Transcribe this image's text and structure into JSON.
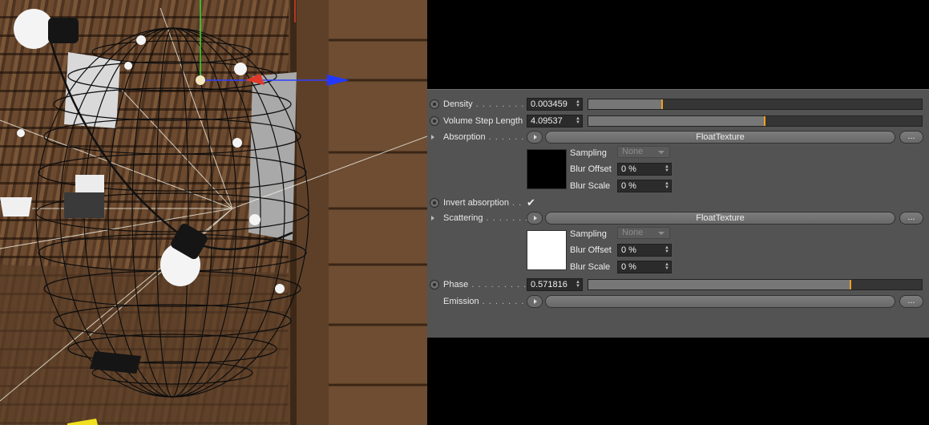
{
  "panel": {
    "density": {
      "label": "Density",
      "dots": " . . . . . . . . .",
      "value": "0.003459",
      "level": 0.22
    },
    "volume_step": {
      "label": "Volume Step Length",
      "value": "4.09537",
      "level": 0.53
    },
    "absorption": {
      "label": "Absorption",
      "dots": " . . . . . . .",
      "texture": "FloatTexture",
      "more": "...",
      "swatch_color": "#000000",
      "sampling_label": "Sampling",
      "sampling_value": "None",
      "blur_offset_label": "Blur Offset",
      "blur_offset_value": "0 %",
      "blur_scale_label": "Blur Scale",
      "blur_scale_value": "0 %"
    },
    "invert_absorption": {
      "label": "Invert absorption",
      "dots": " . .",
      "checked_glyph": "✔"
    },
    "scattering": {
      "label": "Scattering",
      "dots": " . . . . . . . .",
      "texture": "FloatTexture",
      "more": "...",
      "swatch_color": "#ffffff",
      "sampling_label": "Sampling",
      "sampling_value": "None",
      "blur_offset_label": "Blur Offset",
      "blur_offset_value": "0 %",
      "blur_scale_label": "Blur Scale",
      "blur_scale_value": "0 %"
    },
    "phase": {
      "label": "Phase",
      "dots": " . . . . . . . . . . .",
      "value": "0.571816",
      "level": 0.785
    },
    "emission": {
      "label": "Emission",
      "dots": " . . . . . . . . .",
      "more": "..."
    }
  },
  "colors": {
    "panel_bg": "#535353",
    "slider_handle": "#f0a020"
  }
}
